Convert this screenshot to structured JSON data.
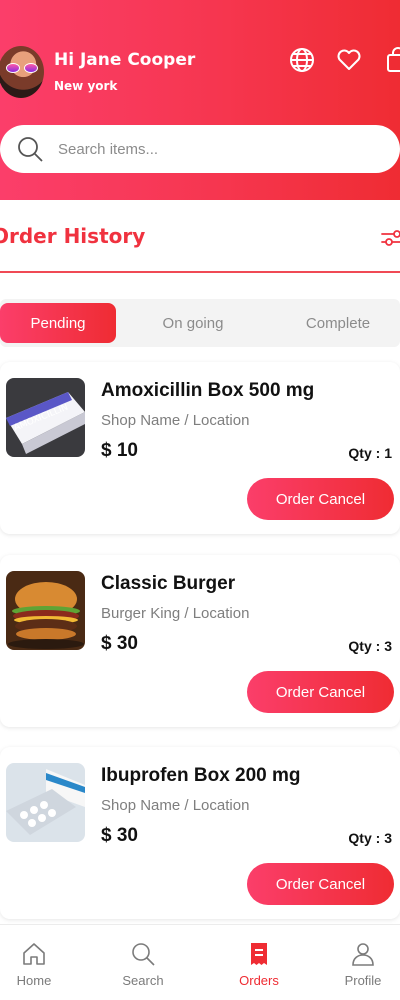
{
  "header": {
    "greeting": "Hi Jane Cooper",
    "location": "New york",
    "icons": [
      "globe-icon",
      "heart-icon",
      "bag-icon"
    ]
  },
  "search": {
    "placeholder": "Search items..."
  },
  "section": {
    "title": "Order History"
  },
  "tabs": [
    {
      "label": "Pending",
      "active": true
    },
    {
      "label": "On going",
      "active": false
    },
    {
      "label": "Complete",
      "active": false
    }
  ],
  "orders": [
    {
      "name": "Amoxicillin Box 500 mg",
      "shop": "Shop Name / Location",
      "price": "$ 10",
      "qty": "Qty : 1",
      "action": "Order Cancel"
    },
    {
      "name": "Classic Burger",
      "shop": "Burger King / Location",
      "price": "$ 30",
      "qty": "Qty : 3",
      "action": "Order Cancel"
    },
    {
      "name": "Ibuprofen Box 200 mg",
      "shop": "Shop Name / Location",
      "price": "$ 30",
      "qty": "Qty : 3",
      "action": "Order Cancel"
    }
  ],
  "nav": [
    {
      "label": "Home",
      "icon": "home-icon"
    },
    {
      "label": "Search",
      "icon": "search-icon"
    },
    {
      "label": "Orders",
      "icon": "receipt-icon",
      "active": true
    },
    {
      "label": "Profile",
      "icon": "user-icon"
    }
  ],
  "colors": {
    "accent": "#f0323f",
    "gradient_start": "#fb3e6a",
    "gradient_end": "#ef2c33"
  }
}
